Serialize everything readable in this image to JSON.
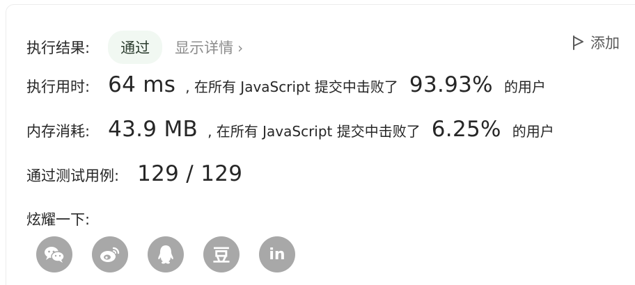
{
  "result": {
    "label": "执行结果:",
    "status": "通过",
    "detail_link": "显示详情",
    "detail_chevron": "›",
    "add_note": "添加"
  },
  "runtime": {
    "label": "执行用时:",
    "value": "64 ms",
    "mid_text": ", 在所有 JavaScript 提交中击败了",
    "percent": "93.93%",
    "suffix": "的用户"
  },
  "memory": {
    "label": "内存消耗:",
    "value": "43.9 MB",
    "mid_text": ", 在所有 JavaScript 提交中击败了",
    "percent": "6.25%",
    "suffix": "的用户"
  },
  "tests": {
    "label": "通过测试用例:",
    "value": "129 / 129"
  },
  "share": {
    "label": "炫耀一下:",
    "icons": [
      "wechat-icon",
      "weibo-icon",
      "qq-icon",
      "douban-icon",
      "linkedin-icon"
    ],
    "douban_glyph": "豆",
    "linkedin_glyph": "in"
  },
  "colors": {
    "pill_bg": "#f1f8f2",
    "icon_bg": "#a8a8a8",
    "muted": "#8c8c8c"
  }
}
